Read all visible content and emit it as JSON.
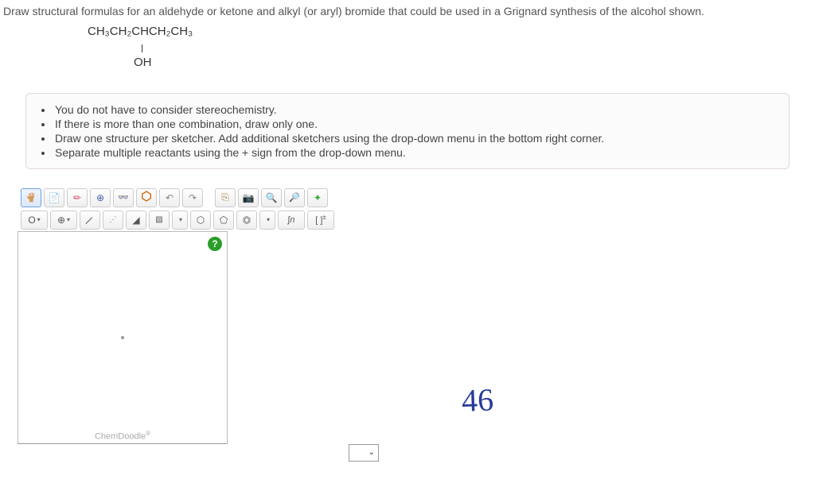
{
  "question": {
    "prompt": "Draw structural formulas for an aldehyde or ketone and alkyl (or aryl) bromide that could be used in a Grignard synthesis of the alcohol shown.",
    "formula_line1": "CH₃CH₂CHCH₂CH₃",
    "formula_line2": "OH"
  },
  "instructions": {
    "items": [
      "You do not have to consider stereochemistry.",
      "If there is more than one combination, draw only one.",
      "Draw one structure per sketcher. Add additional sketchers using the drop-down menu in the bottom right corner.",
      "Separate multiple reactants using the + sign from the drop-down menu."
    ]
  },
  "sketcher": {
    "watermark": "ChemDoodle",
    "help_icon": "?",
    "element_button": "O",
    "toolbar_row1": [
      "hand",
      "trash",
      "eraser",
      "move",
      "glasses",
      "benzene",
      "undo",
      "redo",
      "",
      "copy",
      "paste",
      "zoom-in",
      "zoom-out",
      "refresh"
    ],
    "toolbar_row2_labels": [
      "O ▾",
      "⊕ ▾",
      "/",
      "⋯",
      "◢",
      "▨",
      "▾",
      "⬡",
      "⬠",
      "⬡",
      "▾",
      "∫n",
      "[ ]±"
    ]
  },
  "handwritten_note": "46"
}
